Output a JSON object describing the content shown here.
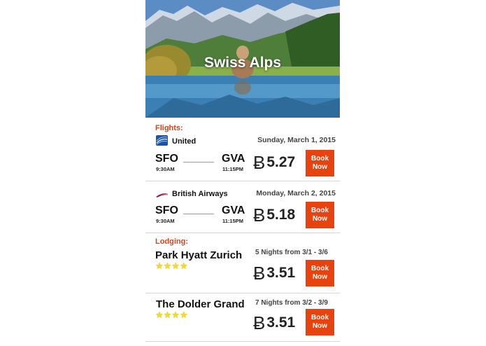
{
  "hero": {
    "title": "Swiss Alps"
  },
  "flights": {
    "label": "Flights:",
    "items": [
      {
        "airline": "United",
        "date": "Sunday, March 1, 2015",
        "from": "SFO",
        "from_time": "9:30AM",
        "to": "GVA",
        "to_time": "11:15PM",
        "currency_symbol": "Ƀ",
        "price": "5.27",
        "book_line1": "Book",
        "book_line2": "Now"
      },
      {
        "airline": "British Airways",
        "date": "Monday, March 2, 2015",
        "from": "SFO",
        "from_time": "9:30AM",
        "to": "GVA",
        "to_time": "11:15PM",
        "currency_symbol": "Ƀ",
        "price": "5.18",
        "book_line1": "Book",
        "book_line2": "Now"
      }
    ]
  },
  "lodging": {
    "label": "Lodging:",
    "items": [
      {
        "name": "Park Hyatt Zurich",
        "stars": "★★★★",
        "rating": 4,
        "nights": "5 Nights from 3/1 - 3/6",
        "currency_symbol": "Ƀ",
        "price": "3.51",
        "book_line1": "Book",
        "book_line2": "Now"
      },
      {
        "name": "The Dolder Grand",
        "stars": "★★★★",
        "rating": 4,
        "nights": "7 Nights from 3/2 - 3/9",
        "currency_symbol": "Ƀ",
        "price": "3.51",
        "book_line1": "Book",
        "book_line2": "Now"
      }
    ]
  },
  "colors": {
    "accent": "#e8420f",
    "section_label": "#d9431e",
    "stars": "#f2dc22",
    "united_blue": "#1a56a8"
  }
}
